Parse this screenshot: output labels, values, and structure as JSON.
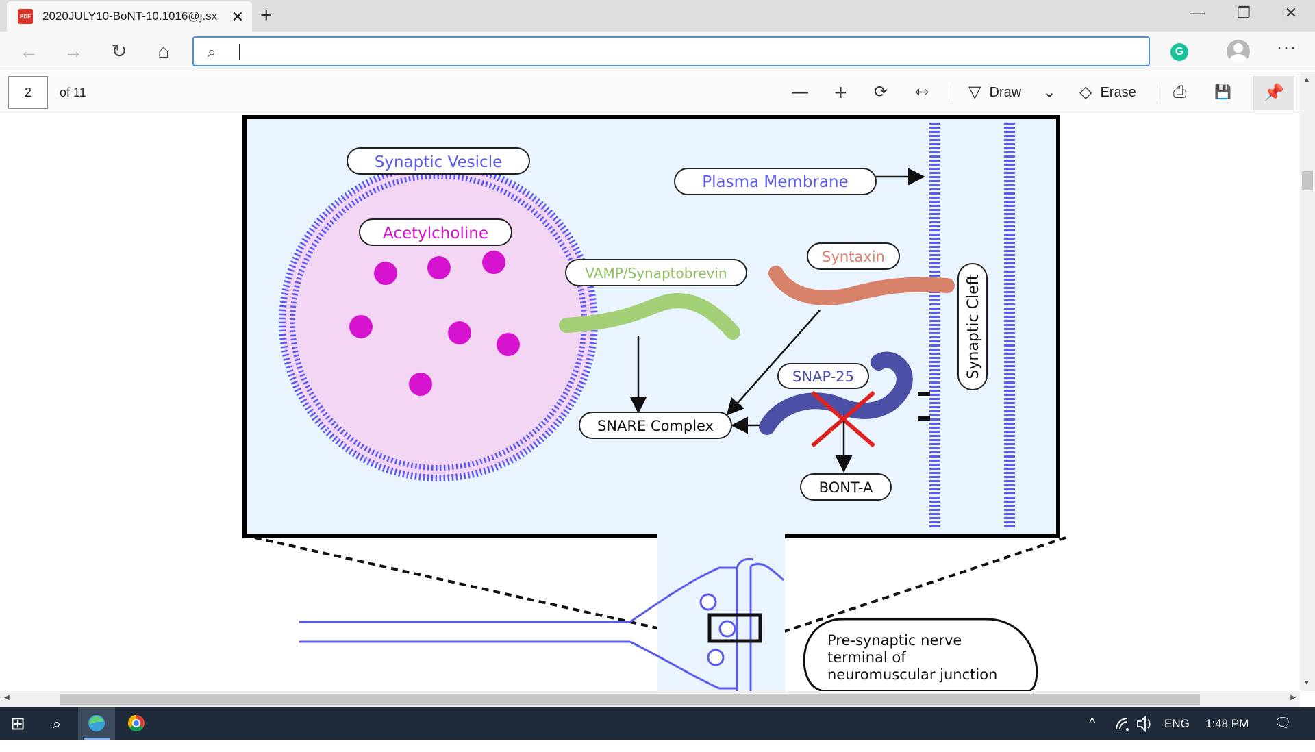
{
  "browser": {
    "tab": {
      "icon_label": "PDF",
      "title": "2020JULY10-BoNT-10.1016@j.sx",
      "close": "✕"
    },
    "new_tab": "+",
    "window": {
      "minimize": "—",
      "restore": "❐",
      "close": "✕"
    },
    "nav": {
      "back": "←",
      "forward": "→",
      "refresh": "↻",
      "home": "⌂"
    },
    "address": {
      "value": "",
      "search_icon": "⌕"
    },
    "extension_grammarly": "G",
    "more": "···"
  },
  "pdf_toolbar": {
    "page_number": "2",
    "page_of": "of 11",
    "zoom_out": "—",
    "zoom_in": "+",
    "rotate": "⟳",
    "fit": "⇿",
    "draw_label": "Draw",
    "draw_dropdown": "⌄",
    "erase_label": "Erase",
    "print": "⎙",
    "save": "💾",
    "pin": "📌"
  },
  "diagram": {
    "labels": {
      "synaptic_vesicle": "Synaptic Vesicle",
      "acetylcholine": "Acetylcholine",
      "plasma_membrane": "Plasma Membrane",
      "syntaxin": "Syntaxin",
      "vamp": "VAMP/Synaptobrevin",
      "synaptic_cleft": "Synaptic Cleft",
      "snap25": "SNAP-25",
      "snare_complex": "SNARE Complex",
      "bont_a": "BONT-A",
      "terminal_line1": "Pre-synaptic nerve",
      "terminal_line2": "terminal of",
      "terminal_line3": "neuromuscular junction"
    },
    "colors": {
      "membrane_blue": "#5b5bef",
      "panel_bg": "#eaf4ff",
      "vesicle_fill": "#f3d6f3",
      "acetylcholine_dot": "#d614d0",
      "vamp_green": "#a3d076",
      "syntaxin_orange": "#d9826a",
      "snap25_blue": "#4b4fa6",
      "cross_red": "#dd2222"
    }
  },
  "taskbar": {
    "start": "⊞",
    "search": "⌕",
    "tray_chevron": "^",
    "lang": "ENG",
    "time": "1:48 PM",
    "notifications": "🗨"
  }
}
